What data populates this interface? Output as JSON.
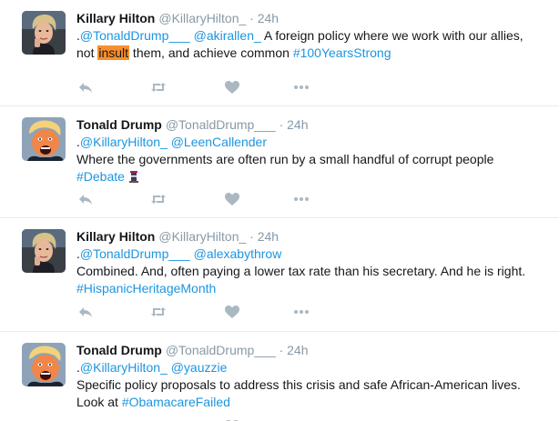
{
  "tweets": [
    {
      "author": {
        "name": "Killary Hilton",
        "handle": "@KillaryHilton_",
        "avatar": "clinton-avatar"
      },
      "dot": "·",
      "time": "24h",
      "lines": [
        {
          "parts": [
            {
              "text": ".",
              "kind": "text"
            },
            {
              "text": "@TonaldDrump___",
              "kind": "link"
            },
            {
              "text": " ",
              "kind": "text"
            },
            {
              "text": "@akirallen_",
              "kind": "link"
            },
            {
              "text": " A foreign policy where we work with our allies,",
              "kind": "text"
            }
          ]
        },
        {
          "parts": [
            {
              "text": "not ",
              "kind": "text"
            },
            {
              "text": "insult",
              "kind": "highlight"
            },
            {
              "text": " them, and achieve common ",
              "kind": "text"
            },
            {
              "text": "#100YearsStrong",
              "kind": "link"
            }
          ]
        }
      ]
    },
    {
      "author": {
        "name": "Tonald Drump",
        "handle": "@TonaldDrump___",
        "avatar": "trump-avatar"
      },
      "dot": "·",
      "time": "24h",
      "lines": [
        {
          "parts": [
            {
              "text": ".",
              "kind": "text"
            },
            {
              "text": "@KillaryHilton_",
              "kind": "link"
            },
            {
              "text": " ",
              "kind": "text"
            },
            {
              "text": "@LeenCallender",
              "kind": "link"
            }
          ]
        },
        {
          "parts": [
            {
              "text": "Where the governments are often run by a small handful of corrupt people",
              "kind": "text"
            }
          ]
        },
        {
          "parts": [
            {
              "text": "#Debate",
              "kind": "link"
            },
            {
              "text": " ",
              "kind": "text"
            },
            {
              "text": "",
              "kind": "podium-emoji"
            }
          ]
        }
      ]
    },
    {
      "author": {
        "name": "Killary Hilton",
        "handle": "@KillaryHilton_",
        "avatar": "clinton-avatar"
      },
      "dot": "·",
      "time": "24h",
      "lines": [
        {
          "parts": [
            {
              "text": ".",
              "kind": "text"
            },
            {
              "text": "@TonaldDrump___",
              "kind": "link"
            },
            {
              "text": " ",
              "kind": "text"
            },
            {
              "text": "@alexabythrow",
              "kind": "link"
            }
          ]
        },
        {
          "parts": [
            {
              "text": "Combined. And, often paying a lower tax rate than his secretary. And he is right.",
              "kind": "text"
            }
          ]
        },
        {
          "parts": [
            {
              "text": "#HispanicHeritageMonth",
              "kind": "link"
            }
          ]
        }
      ]
    },
    {
      "author": {
        "name": "Tonald Drump",
        "handle": "@TonaldDrump___",
        "avatar": "trump-avatar"
      },
      "dot": "·",
      "time": "24h",
      "lines": [
        {
          "parts": [
            {
              "text": ".",
              "kind": "text"
            },
            {
              "text": "@KillaryHilton_",
              "kind": "link"
            },
            {
              "text": " ",
              "kind": "text"
            },
            {
              "text": "@yauzzie",
              "kind": "link"
            }
          ]
        },
        {
          "parts": [
            {
              "text": "Specific policy proposals to address this crisis and safe African-American lives.",
              "kind": "text"
            }
          ]
        },
        {
          "parts": [
            {
              "text": "Look at ",
              "kind": "text"
            },
            {
              "text": "#ObamacareFailed",
              "kind": "link"
            }
          ]
        }
      ]
    }
  ],
  "actions": [
    {
      "name": "reply",
      "icon": "reply-icon"
    },
    {
      "name": "retweet",
      "icon": "retweet-icon"
    },
    {
      "name": "like",
      "icon": "heart-icon"
    },
    {
      "name": "more",
      "icon": "more-icon"
    }
  ],
  "colors": {
    "link": "#1b95e0",
    "muted": "#8899a6",
    "icon": "#aab8c2",
    "highlight": "#f98f2c",
    "divider": "#e6ecf0"
  }
}
